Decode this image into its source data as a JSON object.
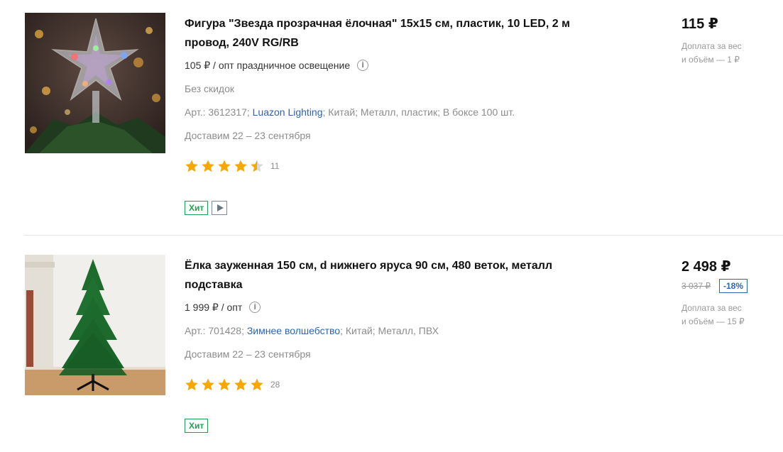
{
  "products": [
    {
      "title_line1": "Фигура \"Звезда прозрачная ёлочная\" 15х15 см, пластик, 10 LED, 2 м",
      "title_line2": "провод, 240V RG/RB",
      "opt_price": "105 ₽ / опт праздничное освещение",
      "discount_text": "Без скидок",
      "article": "Арт.: 3612317;",
      "brand": "Luazon Lighting",
      "country": "Китай;",
      "material": "Металл, пластик;",
      "box": "В боксе 100 шт.",
      "delivery": "Доставим 22 – 23 сентября",
      "rating": 4.5,
      "reviews": "11",
      "badge": "Хит",
      "has_video": true,
      "price": "115 ₽",
      "surcharge_line1": "Доплата за вес",
      "surcharge_line2": "и объём — 1 ₽"
    },
    {
      "title_line1": "Ёлка зауженная 150 см, d нижнего яруса 90 см, 480 веток, металл",
      "title_line2": "подставка",
      "opt_price": "1 999 ₽ / опт",
      "article": "Арт.: 701428;",
      "brand": "Зимнее волшебство",
      "country": "Китай;",
      "material": "Металл, ПВХ",
      "delivery": "Доставим 22 – 23 сентября",
      "rating": 5,
      "reviews": "28",
      "badge": "Хит",
      "price": "2 498 ₽",
      "old_price": "3 037 ₽",
      "discount": "-18%",
      "surcharge_line1": "Доплата за вес",
      "surcharge_line2": "и объём — 15 ₽"
    }
  ],
  "icons": {
    "info": "info-icon",
    "star": "star-icon",
    "play": "play-icon"
  },
  "colors": {
    "brand_link": "#2d64b3",
    "hit_badge": "#1ea352",
    "star": "#f6a700",
    "discount": "#2d64b3"
  }
}
